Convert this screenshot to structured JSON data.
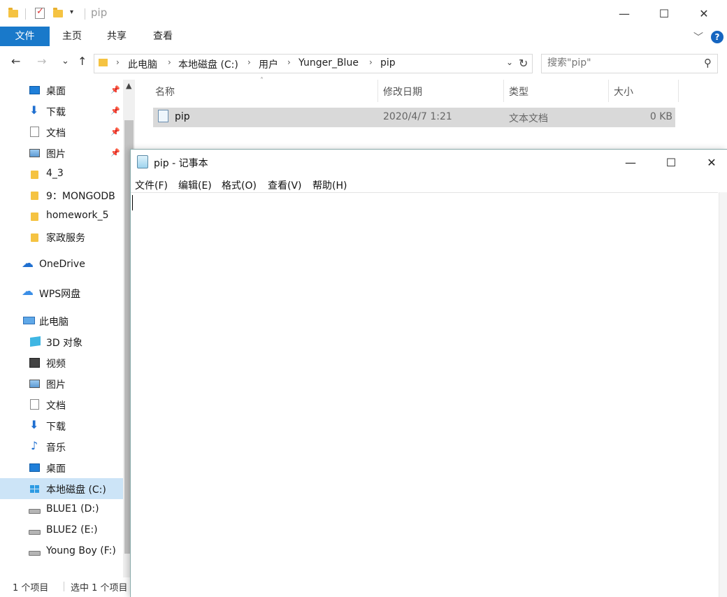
{
  "explorer": {
    "title": "pip",
    "quick_access_dropdown": "▾",
    "window_controls": {
      "minimize": "—",
      "maximize": "☐",
      "close": "✕"
    },
    "ribbon": {
      "tabs": [
        "文件",
        "主页",
        "共享",
        "查看"
      ],
      "collapse_glyph": "﹀",
      "help_glyph": "?"
    },
    "nav": {
      "back": "←",
      "forward": "→",
      "recent": "⌄",
      "up": "↑"
    },
    "address": {
      "breadcrumbs": [
        "此电脑",
        "本地磁盘 (C:)",
        "用户",
        "Yunger_Blue",
        "pip"
      ],
      "separator": "›",
      "dropdown": "⌄",
      "refresh": "↻"
    },
    "search": {
      "placeholder": "搜索\"pip\"",
      "icon": "⚲"
    },
    "sidebar": {
      "items": [
        {
          "label": "桌面",
          "icon": "desktop-icon",
          "pinned": true
        },
        {
          "label": "下载",
          "icon": "download-icon",
          "pinned": true
        },
        {
          "label": "文档",
          "icon": "document-icon",
          "pinned": true
        },
        {
          "label": "图片",
          "icon": "picture-icon",
          "pinned": true
        },
        {
          "label": "4_3",
          "icon": "folder-icon"
        },
        {
          "label": "9：MONGODB",
          "icon": "folder-icon"
        },
        {
          "label": "homework_5",
          "icon": "folder-icon"
        },
        {
          "label": "家政服务",
          "icon": "folder-icon"
        },
        {
          "label": "OneDrive",
          "icon": "onedrive-icon"
        },
        {
          "label": "WPS网盘",
          "icon": "wps-cloud-icon"
        },
        {
          "label": "此电脑",
          "icon": "this-pc-icon"
        },
        {
          "label": "3D 对象",
          "icon": "3d-objects-icon"
        },
        {
          "label": "视频",
          "icon": "video-icon"
        },
        {
          "label": "图片",
          "icon": "picture-icon"
        },
        {
          "label": "文档",
          "icon": "document-icon"
        },
        {
          "label": "下载",
          "icon": "download-icon"
        },
        {
          "label": "音乐",
          "icon": "music-icon"
        },
        {
          "label": "桌面",
          "icon": "desktop-icon"
        },
        {
          "label": "本地磁盘 (C:)",
          "icon": "windows-drive-icon",
          "selected": true
        },
        {
          "label": "BLUE1 (D:)",
          "icon": "drive-icon"
        },
        {
          "label": "BLUE2 (E:)",
          "icon": "drive-icon"
        },
        {
          "label": "Young Boy (F:)",
          "icon": "drive-icon"
        }
      ],
      "pin_glyph": "📌",
      "scroll_up": "▲"
    },
    "file_list": {
      "columns": [
        "名称",
        "修改日期",
        "类型",
        "大小"
      ],
      "sort_indicator": "˄",
      "rows": [
        {
          "name": "pip",
          "modified": "2020/4/7 1:21",
          "type": "文本文档",
          "size": "0 KB"
        }
      ]
    },
    "status": {
      "count": "1 个项目",
      "selected": "选中 1 个项目"
    }
  },
  "notepad": {
    "title": "pip - 记事本",
    "window_controls": {
      "minimize": "—",
      "maximize": "☐",
      "close": "✕"
    },
    "menu": [
      "文件(F)",
      "编辑(E)",
      "格式(O)",
      "查看(V)",
      "帮助(H)"
    ],
    "content": ""
  }
}
